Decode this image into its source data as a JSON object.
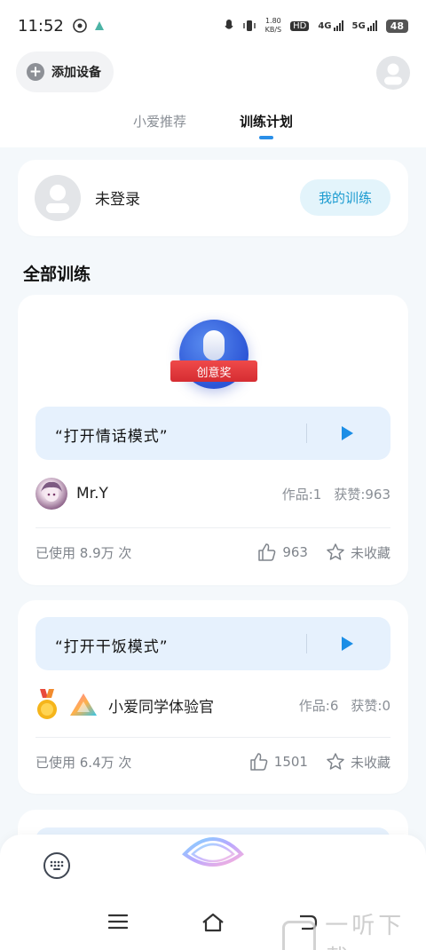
{
  "status_bar": {
    "time": "11:52",
    "net_speed_top": "1.80",
    "net_speed_bottom": "KB/S",
    "hd_label": "HD",
    "net_4g": "4G",
    "net_5g": "5G",
    "battery": "48"
  },
  "header": {
    "add_device_label": "添加设备",
    "tabs": [
      {
        "label": "小爱推荐",
        "active": false
      },
      {
        "label": "训练计划",
        "active": true
      }
    ]
  },
  "login_card": {
    "status_text": "未登录",
    "my_training_label": "我的训练"
  },
  "section_title": "全部训练",
  "trainings": [
    {
      "award_label": "创意奖",
      "phrase": "“打开情话模式”",
      "author": "Mr.Y",
      "works": "作品:1",
      "likes_total": "获赞:963",
      "usage": "已使用 8.9万 次",
      "like_count": "963",
      "favorite_label": "未收藏"
    },
    {
      "phrase": "“打开干饭模式”",
      "author": "小爱同学体验官",
      "works": "作品:6",
      "likes_total": "获赞:0",
      "usage": "已使用 6.4万 次",
      "like_count": "1501",
      "favorite_label": "未收藏"
    }
  ],
  "watermark": "一听下载",
  "colors": {
    "accent_blue": "#2a8fe8",
    "my_training_bg": "#e3f4fb",
    "my_training_text": "#1b9bd0",
    "phrase_bg": "#e6f1fd",
    "award_red": "#e0353a"
  }
}
